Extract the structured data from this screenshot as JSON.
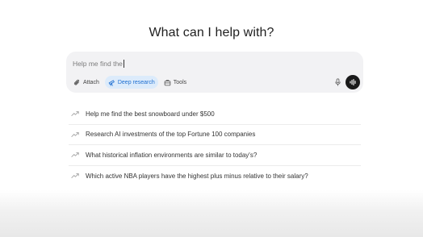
{
  "heading": "What can I help with?",
  "composer": {
    "input_value": "Help me find the",
    "tools": [
      {
        "label": "Attach",
        "icon": "paperclip-icon",
        "active": false
      },
      {
        "label": "Deep research",
        "icon": "telescope-icon",
        "active": true
      },
      {
        "label": "Tools",
        "icon": "toolbox-icon",
        "active": false
      }
    ],
    "mic_icon": "microphone-icon",
    "voice_icon": "voice-waveform-icon"
  },
  "suggestions": [
    {
      "icon": "trending-up-icon",
      "text": "Help me find the best snowboard under $500"
    },
    {
      "icon": "trending-up-icon",
      "text": "Research AI investments of the top Fortune 100 companies"
    },
    {
      "icon": "trending-up-icon",
      "text": "What historical inflation environments are similar to today's?"
    },
    {
      "icon": "trending-up-icon",
      "text": "Which active NBA players have the highest plus minus relative to their salary?"
    }
  ],
  "colors": {
    "active_tool_bg": "#dcebfb",
    "active_tool_text": "#1f6fd1",
    "composer_bg": "#f2f2f4",
    "voice_button_bg": "#1a1a1a"
  }
}
